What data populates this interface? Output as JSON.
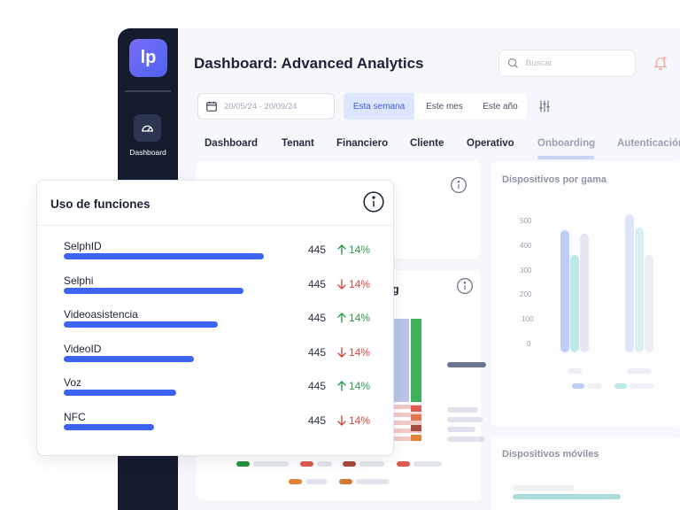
{
  "sidebar": {
    "logo": "lp",
    "nav_item": "Dashboard"
  },
  "header": {
    "title": "Dashboard: Advanced Analytics",
    "search_placeholder": "Buscar"
  },
  "filters": {
    "date_range": "20/05/24 - 20/09/24",
    "segments": [
      "Esta semana",
      "Este mes",
      "Este año"
    ],
    "active_segment": "Esta semana"
  },
  "tabs": [
    "Dashboard",
    "Tenant",
    "Financiero",
    "Cliente",
    "Operativo",
    "Onboarding",
    "Autenticación"
  ],
  "cards": {
    "partial_title_suffix": "g",
    "devices_by_range": {
      "title": "Dispositivos por gama",
      "ticks": [
        "500",
        "400",
        "300",
        "200",
        "100",
        "0"
      ]
    },
    "mobile_devices": {
      "title": "Dispositivos móviles"
    }
  },
  "feature_usage": {
    "title": "Uso de funciones",
    "rows": [
      {
        "label": "SelphID",
        "value": "445",
        "delta": "14%",
        "direction": "up",
        "share": 1.0
      },
      {
        "label": "Selphi",
        "value": "445",
        "delta": "14%",
        "direction": "down",
        "share": 0.9
      },
      {
        "label": "Videoasistencia",
        "value": "445",
        "delta": "14%",
        "direction": "up",
        "share": 0.77
      },
      {
        "label": "VideoID",
        "value": "445",
        "delta": "14%",
        "direction": "down",
        "share": 0.65
      },
      {
        "label": "Voz",
        "value": "445",
        "delta": "14%",
        "direction": "up",
        "share": 0.56
      },
      {
        "label": "NFC",
        "value": "445",
        "delta": "14%",
        "direction": "down",
        "share": 0.45
      }
    ]
  },
  "colors": {
    "accent": "#3d63f2",
    "up": "#2e9a4e",
    "down": "#d9453e"
  }
}
